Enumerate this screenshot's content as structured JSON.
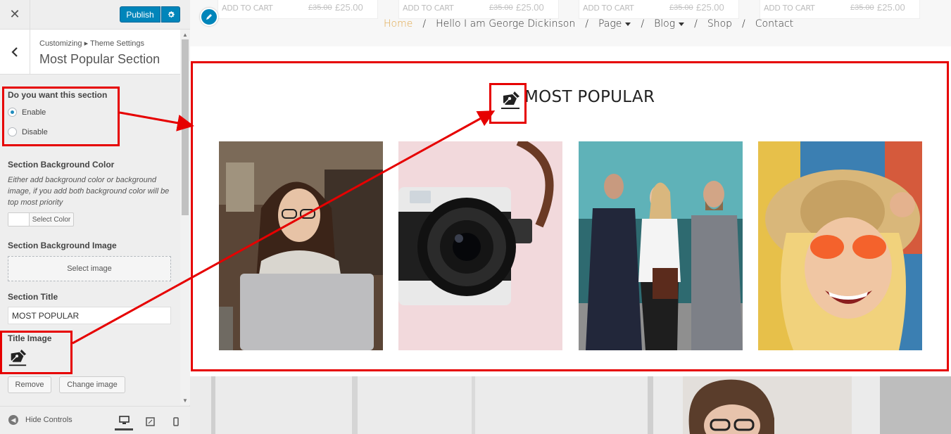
{
  "topbar": {
    "publish_label": "Publish"
  },
  "section": {
    "breadcrumb": "Customizing ▸ Theme Settings",
    "title": "Most Popular Section"
  },
  "controls": {
    "enable_question": "Do you want this section",
    "enable_option": "Enable",
    "disable_option": "Disable",
    "selected": "Enable",
    "bg_color_label": "Section Background Color",
    "bg_color_desc": "Either add background color or background image, if you add both background color will be top most priority",
    "select_color_label": "Select Color",
    "bg_image_label": "Section Background Image",
    "select_image_label": "Select image",
    "section_title_label": "Section Title",
    "section_title_value": "MOST POPULAR",
    "title_image_label": "Title Image",
    "remove_label": "Remove",
    "change_image_label": "Change image"
  },
  "footer": {
    "hide_controls_label": "Hide Controls"
  },
  "preview": {
    "products": [
      {
        "add_to_cart": "ADD TO CART",
        "old_price": "£35.00",
        "new_price": "£25.00"
      },
      {
        "add_to_cart": "ADD TO CART",
        "old_price": "£35.00",
        "new_price": "£25.00"
      },
      {
        "add_to_cart": "ADD TO CART",
        "old_price": "£35.00",
        "new_price": "£25.00"
      },
      {
        "add_to_cart": "ADD TO CART",
        "old_price": "£35.00",
        "new_price": "£25.00"
      }
    ],
    "nav": [
      "Home",
      "Hello I am George Dickinson",
      "Page",
      "Blog",
      "Shop",
      "Contact"
    ],
    "nav_separator": "/",
    "section_heading": "MOST POPULAR"
  },
  "colors": {
    "accent": "#0085ba",
    "annotation": "#e60000",
    "nav_active": "#e0a84c"
  }
}
